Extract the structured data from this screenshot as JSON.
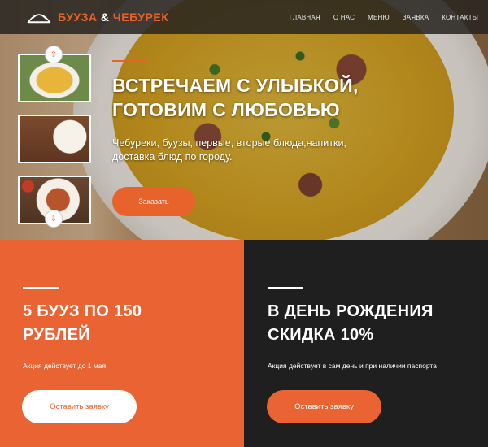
{
  "brand": {
    "part1": "БУУЗА",
    "amp": "&",
    "part2": "ЧЕБУРЕК",
    "accent_color": "#e8622c"
  },
  "nav": {
    "items": [
      "ГЛАВНАЯ",
      "О НАС",
      "МЕНЮ",
      "ЗАЯВКА",
      "КОНТАКТЫ"
    ]
  },
  "gallery": {
    "up_icon": "arrow-up-icon",
    "down_icon": "arrow-down-icon"
  },
  "hero": {
    "title_line1": "ВСТРЕЧАЕМ С УЛЫБКОЙ,",
    "title_line2": "ГОТОВИМ С ЛЮБОВЬЮ",
    "subtitle": "Чебуреки, буузы, первые, вторые блюда,напитки, доставка блюд по городу.",
    "order_button": "Заказать"
  },
  "promos": [
    {
      "title_line1": "5 БУУЗ ПО 150",
      "title_line2": "РУБЛЕЙ",
      "note": "Акция действует до 1 мая",
      "button": "Оставить заявку",
      "background": "#ea6332"
    },
    {
      "title_line1": "В ДЕНЬ РОЖДЕНИЯ",
      "title_line2": "СКИДКА 10%",
      "note": "Акция действует в сам день и при наличии паспорта",
      "button": "Оставить заявку",
      "background": "#1f1f1f"
    }
  ]
}
